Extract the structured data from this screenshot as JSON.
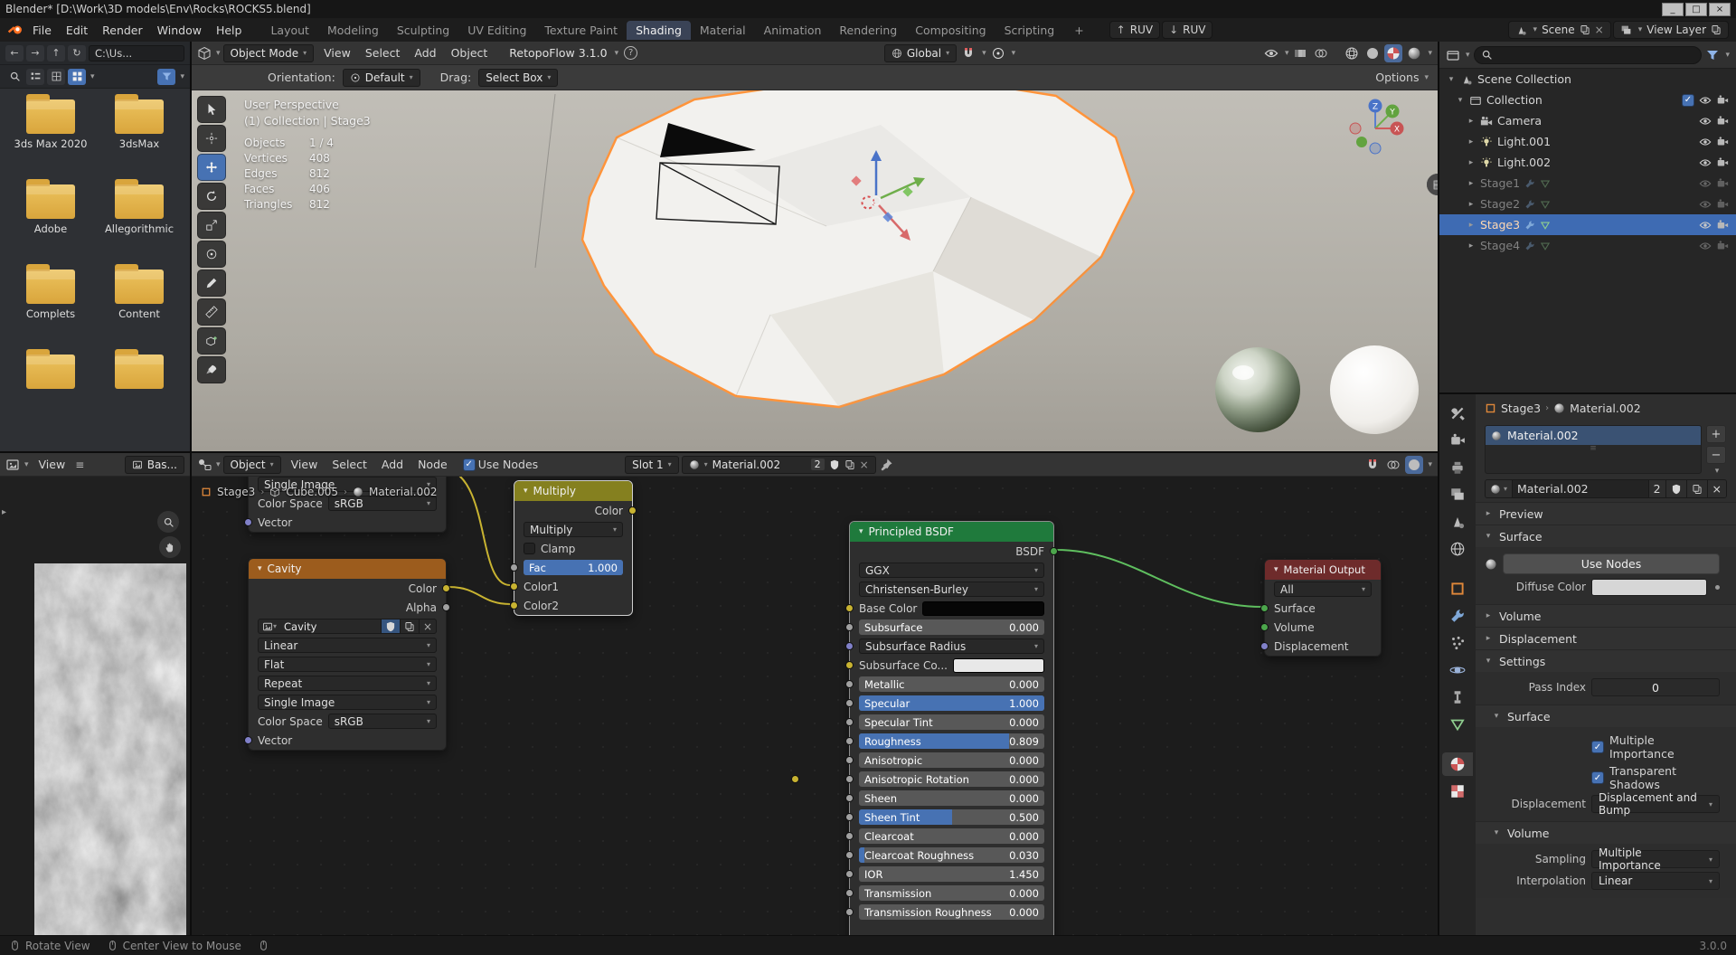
{
  "titlebar": {
    "title": "Blender* [D:\\Work\\3D models\\Env\\Rocks\\ROCKS5.blend]"
  },
  "topbar": {
    "menus": [
      "File",
      "Edit",
      "Render",
      "Window",
      "Help"
    ],
    "tabs": [
      "Layout",
      "Modeling",
      "Sculpting",
      "UV Editing",
      "Texture Paint",
      "Shading",
      "Material",
      "Animation",
      "Rendering",
      "Compositing",
      "Scripting"
    ],
    "active_tab": "Shading",
    "add_tab": "+",
    "ruv1": "RUV",
    "ruv2": "RUV",
    "scene": "Scene",
    "view_layer": "View Layer"
  },
  "viewport": {
    "mode": "Object Mode",
    "menus": [
      "View",
      "Select",
      "Add",
      "Object"
    ],
    "addon": "RetopoFlow 3.1.0",
    "transform_space": "Global",
    "orientation_label": "Orientation:",
    "orientation": "Default",
    "drag_label": "Drag:",
    "drag": "Select Box",
    "options": "Options",
    "overlay_perspective": "User Perspective",
    "overlay_context": "(1) Collection | Stage3",
    "stats": [
      {
        "label": "Objects",
        "value": "1 / 4"
      },
      {
        "label": "Vertices",
        "value": "408"
      },
      {
        "label": "Edges",
        "value": "812"
      },
      {
        "label": "Faces",
        "value": "406"
      },
      {
        "label": "Triangles",
        "value": "812"
      }
    ],
    "axis": {
      "x": "X",
      "y": "Y",
      "z": "Z"
    }
  },
  "file_browser": {
    "path": "C:\\Us...",
    "folders": [
      "3ds Max 2020",
      "3dsMax",
      "Adobe",
      "Allegorithmic",
      "Complets",
      "Content",
      "",
      ""
    ]
  },
  "image_editor": {
    "view_menu": "View",
    "image_name": "Bas..."
  },
  "outliner": {
    "scene_collection": "Scene Collection",
    "collection": "Collection",
    "items": [
      {
        "label": "Camera",
        "icon": "camera",
        "dim": false,
        "selected": false
      },
      {
        "label": "Light.001",
        "icon": "light",
        "dim": false,
        "selected": false
      },
      {
        "label": "Light.002",
        "icon": "light",
        "dim": false,
        "selected": false
      },
      {
        "label": "Stage1",
        "icon": "mesh",
        "dim": true,
        "selected": false
      },
      {
        "label": "Stage2",
        "icon": "mesh",
        "dim": true,
        "selected": false
      },
      {
        "label": "Stage3",
        "icon": "mesh",
        "dim": false,
        "selected": true
      },
      {
        "label": "Stage4",
        "icon": "mesh",
        "dim": true,
        "selected": false
      }
    ]
  },
  "shader_editor": {
    "shader_type": "Object",
    "menus": [
      "View",
      "Select",
      "Add",
      "Node"
    ],
    "use_nodes": "Use Nodes",
    "slot": "Slot 1",
    "material": "Material.002",
    "users": "2",
    "breadcrumb": [
      "Stage3",
      "Cube.005",
      "Material.002"
    ]
  },
  "nodes": {
    "image_partial": {
      "extension": "Single Image",
      "color_space_label": "Color Space",
      "color_space": "sRGB",
      "vector": "Vector"
    },
    "cavity": {
      "title": "Cavity",
      "out_color": "Color",
      "out_alpha": "Alpha",
      "image_name": "Cavity",
      "interpolation": "Linear",
      "projection": "Flat",
      "extension": "Repeat",
      "source": "Single Image",
      "color_space_label": "Color Space",
      "color_space": "sRGB",
      "vector": "Vector"
    },
    "multiply": {
      "title": "Multiply",
      "out_color": "Color",
      "blend_mode": "Multiply",
      "clamp": "Clamp",
      "fac_label": "Fac",
      "fac_value": "1.000",
      "in1": "Color1",
      "in2": "Color2"
    },
    "principled": {
      "title": "Principled BSDF",
      "out": "BSDF",
      "distribution": "GGX",
      "subsurface_method": "Christensen-Burley",
      "rows": [
        {
          "label": "Base Color",
          "type": "color",
          "socket": "yellow"
        },
        {
          "label": "Subsurface",
          "value": "0.000",
          "fill": 0,
          "socket": "gray"
        },
        {
          "label": "Subsurface Radius",
          "type": "dropdown",
          "socket": "purple"
        },
        {
          "label": "Subsurface Co...",
          "type": "color_light",
          "socket": "yellow"
        },
        {
          "label": "Metallic",
          "value": "0.000",
          "fill": 0,
          "socket": "gray"
        },
        {
          "label": "Specular",
          "value": "1.000",
          "fill": 100,
          "socket": "gray"
        },
        {
          "label": "Specular Tint",
          "value": "0.000",
          "fill": 0,
          "socket": "gray"
        },
        {
          "label": "Roughness",
          "value": "0.809",
          "fill": 81,
          "socket": "gray"
        },
        {
          "label": "Anisotropic",
          "value": "0.000",
          "fill": 0,
          "socket": "gray"
        },
        {
          "label": "Anisotropic Rotation",
          "value": "0.000",
          "fill": 0,
          "socket": "gray"
        },
        {
          "label": "Sheen",
          "value": "0.000",
          "fill": 0,
          "socket": "gray"
        },
        {
          "label": "Sheen Tint",
          "value": "0.500",
          "fill": 50,
          "socket": "gray"
        },
        {
          "label": "Clearcoat",
          "value": "0.000",
          "fill": 0,
          "socket": "gray"
        },
        {
          "label": "Clearcoat Roughness",
          "value": "0.030",
          "fill": 3,
          "socket": "gray"
        },
        {
          "label": "IOR",
          "value": "1.450",
          "fill": 0,
          "socket": "gray"
        },
        {
          "label": "Transmission",
          "value": "0.000",
          "fill": 0,
          "socket": "gray"
        },
        {
          "label": "Transmission Roughness",
          "value": "0.000",
          "fill": 0,
          "socket": "gray"
        }
      ]
    },
    "output": {
      "title": "Material Output",
      "target": "All",
      "in_surface": "Surface",
      "in_volume": "Volume",
      "in_displacement": "Displacement"
    }
  },
  "properties": {
    "breadcrumb_object": "Stage3",
    "breadcrumb_material": "Material.002",
    "slot_material": "Material.002",
    "datablock_name": "Material.002",
    "datablock_users": "2",
    "panel_preview": "Preview",
    "panel_surface": "Surface",
    "use_nodes": "Use Nodes",
    "diffuse_label": "Diffuse Color",
    "panel_volume": "Volume",
    "panel_displacement": "Displacement",
    "panel_settings": "Settings",
    "pass_index_label": "Pass Index",
    "pass_index": "0",
    "panel_surface2": "Surface",
    "check_multiple_importance": "Multiple Importance",
    "check_transparent_shadows": "Transparent Shadows",
    "displacement_label": "Displacement",
    "displacement_value": "Displacement and Bump",
    "panel_volume2": "Volume",
    "sampling_label": "Sampling",
    "sampling_value": "Multiple Importance",
    "interpolation_label": "Interpolation",
    "interpolation_value": "Linear"
  },
  "statusbar": {
    "left": [
      "Rotate View",
      "Center View to Mouse"
    ],
    "version": "3.0.0"
  },
  "colors": {
    "accent": "#4772b3",
    "selected_text": "#ffd9b3",
    "node_texture_header": "#9c5c1d",
    "node_color_header": "#85801f",
    "node_shader_header": "#1f7a3c",
    "node_output_header": "#6e2b2b"
  }
}
